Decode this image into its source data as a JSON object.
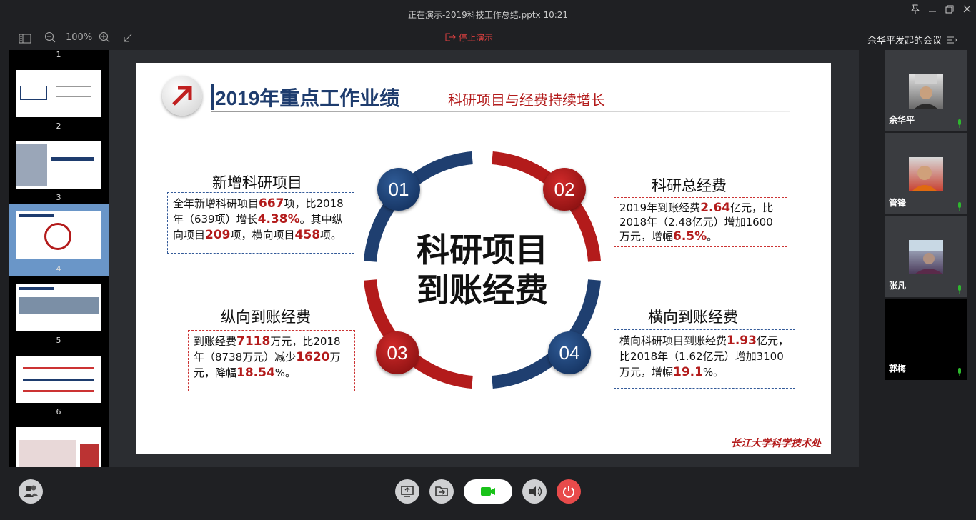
{
  "window": {
    "title": "正在演示-2019科技工作总结.pptx 10:21",
    "pin_icon": "pin-icon",
    "minimize_icon": "minimize-icon",
    "restore_icon": "restore-icon",
    "close_icon": "close-icon"
  },
  "toolbar": {
    "zoom": "100%",
    "stop_label": "停止演示"
  },
  "thumbnails": {
    "numbers": [
      "1",
      "2",
      "3",
      "4",
      "5",
      "6"
    ],
    "selected": "4"
  },
  "slide": {
    "title": "2019年重点工作业绩",
    "subtitle": "科研项目与经费持续增长",
    "center_line1": "科研项目",
    "center_line2": "到账经费",
    "footer": "长江大学科学技术处",
    "items": [
      {
        "num": "01",
        "title": "新增科研项目",
        "parts": [
          "全年新增科研项目",
          "667",
          "项，比2018年（639项）增长",
          "4.38%",
          "。其中纵向项目",
          "209",
          "项，横向项目",
          "458",
          "项。"
        ]
      },
      {
        "num": "02",
        "title": "科研总经费",
        "parts": [
          "2019年到账经费",
          "2.64",
          "亿元，比2018年（2.48亿元）增加1600万元，增幅",
          "6.5%",
          "。"
        ]
      },
      {
        "num": "03",
        "title": "纵向到账经费",
        "parts": [
          "到账经费",
          "7118",
          "万元，比2018年（8738万元）减少",
          "1620",
          "万元，降幅",
          "18.54",
          "%。"
        ]
      },
      {
        "num": "04",
        "title": "横向到账经费",
        "parts": [
          "横向科研项目到账经费",
          "1.93",
          "亿元，比2018年（1.62亿元）增加3100万元，增幅",
          "19.1",
          "%。"
        ]
      }
    ]
  },
  "meeting": {
    "title": "余华平发起的会议",
    "participants": [
      {
        "name": "余华平"
      },
      {
        "name": "管锋"
      },
      {
        "name": "张凡"
      },
      {
        "name": "郭梅"
      }
    ]
  },
  "colors": {
    "accent_red": "#b31b1b",
    "accent_blue": "#1e3c6e",
    "mic_green": "#2eb82e",
    "end_call": "#e84b4b",
    "video_green": "#19c219"
  }
}
